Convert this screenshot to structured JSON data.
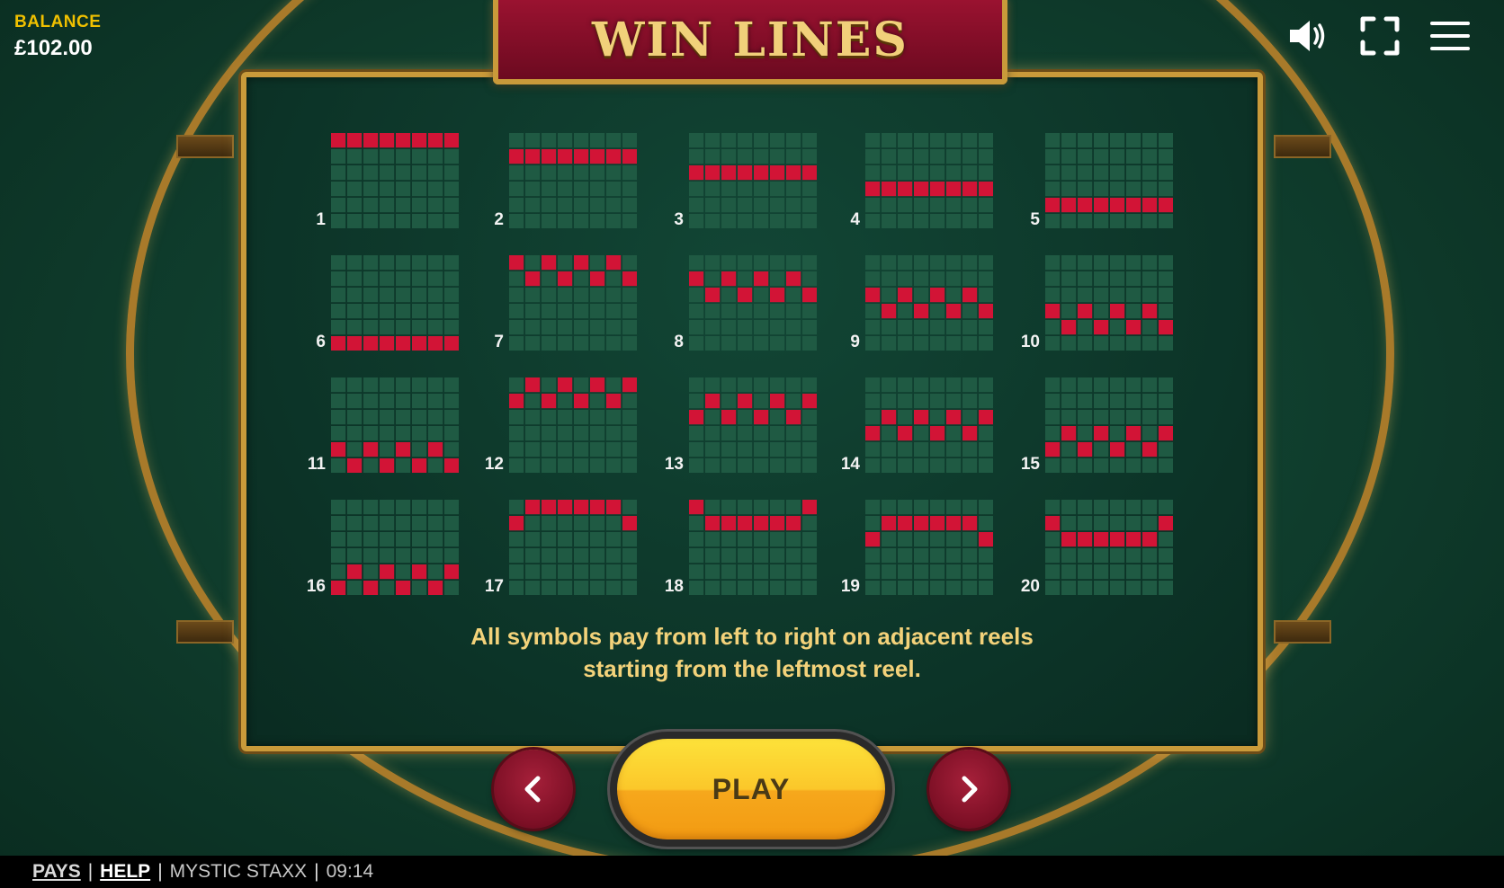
{
  "balance": {
    "label": "BALANCE",
    "value": "£102.00"
  },
  "header": {
    "title": "WIN LINES"
  },
  "top_icons": [
    "speaker-icon",
    "fullscreen-icon",
    "hamburger-menu-icon"
  ],
  "win_lines": {
    "grid_columns": 8,
    "grid_rows": 6,
    "patterns": [
      {
        "number": "1",
        "rows": [
          0,
          0,
          0,
          0,
          0,
          0,
          0,
          0
        ]
      },
      {
        "number": "2",
        "rows": [
          1,
          1,
          1,
          1,
          1,
          1,
          1,
          1
        ]
      },
      {
        "number": "3",
        "rows": [
          2,
          2,
          2,
          2,
          2,
          2,
          2,
          2
        ]
      },
      {
        "number": "4",
        "rows": [
          3,
          3,
          3,
          3,
          3,
          3,
          3,
          3
        ]
      },
      {
        "number": "5",
        "rows": [
          4,
          4,
          4,
          4,
          4,
          4,
          4,
          4
        ]
      },
      {
        "number": "6",
        "rows": [
          5,
          5,
          5,
          5,
          5,
          5,
          5,
          5
        ]
      },
      {
        "number": "7",
        "rows": [
          0,
          1,
          0,
          1,
          0,
          1,
          0,
          1
        ]
      },
      {
        "number": "8",
        "rows": [
          1,
          2,
          1,
          2,
          1,
          2,
          1,
          2
        ]
      },
      {
        "number": "9",
        "rows": [
          2,
          3,
          2,
          3,
          2,
          3,
          2,
          3
        ]
      },
      {
        "number": "10",
        "rows": [
          3,
          4,
          3,
          4,
          3,
          4,
          3,
          4
        ]
      },
      {
        "number": "11",
        "rows": [
          4,
          5,
          4,
          5,
          4,
          5,
          4,
          5
        ]
      },
      {
        "number": "12",
        "rows": [
          1,
          0,
          1,
          0,
          1,
          0,
          1,
          0
        ]
      },
      {
        "number": "13",
        "rows": [
          2,
          1,
          2,
          1,
          2,
          1,
          2,
          1
        ]
      },
      {
        "number": "14",
        "rows": [
          3,
          2,
          3,
          2,
          3,
          2,
          3,
          2
        ]
      },
      {
        "number": "15",
        "rows": [
          4,
          3,
          4,
          3,
          4,
          3,
          4,
          3
        ]
      },
      {
        "number": "16",
        "rows": [
          5,
          4,
          5,
          4,
          5,
          4,
          5,
          4
        ]
      },
      {
        "number": "17",
        "rows": [
          1,
          0,
          0,
          0,
          0,
          0,
          0,
          1
        ]
      },
      {
        "number": "18",
        "rows": [
          0,
          1,
          1,
          1,
          1,
          1,
          1,
          0
        ]
      },
      {
        "number": "19",
        "rows": [
          2,
          1,
          1,
          1,
          1,
          1,
          1,
          2
        ]
      },
      {
        "number": "20",
        "rows": [
          1,
          2,
          2,
          2,
          2,
          2,
          2,
          1
        ]
      }
    ],
    "active_color": "#d21436",
    "cell_color": "#1f5a43"
  },
  "description": {
    "line1": "All symbols pay from left to right on adjacent reels",
    "line2": "starting from the leftmost reel."
  },
  "controls": {
    "play_label": "PLAY",
    "prev_icon": "chevron-left-icon",
    "next_icon": "chevron-right-icon"
  },
  "footer": {
    "pays": "PAYS",
    "help": "HELP",
    "game_name": "MYSTIC STAXX",
    "time": "09:14"
  }
}
